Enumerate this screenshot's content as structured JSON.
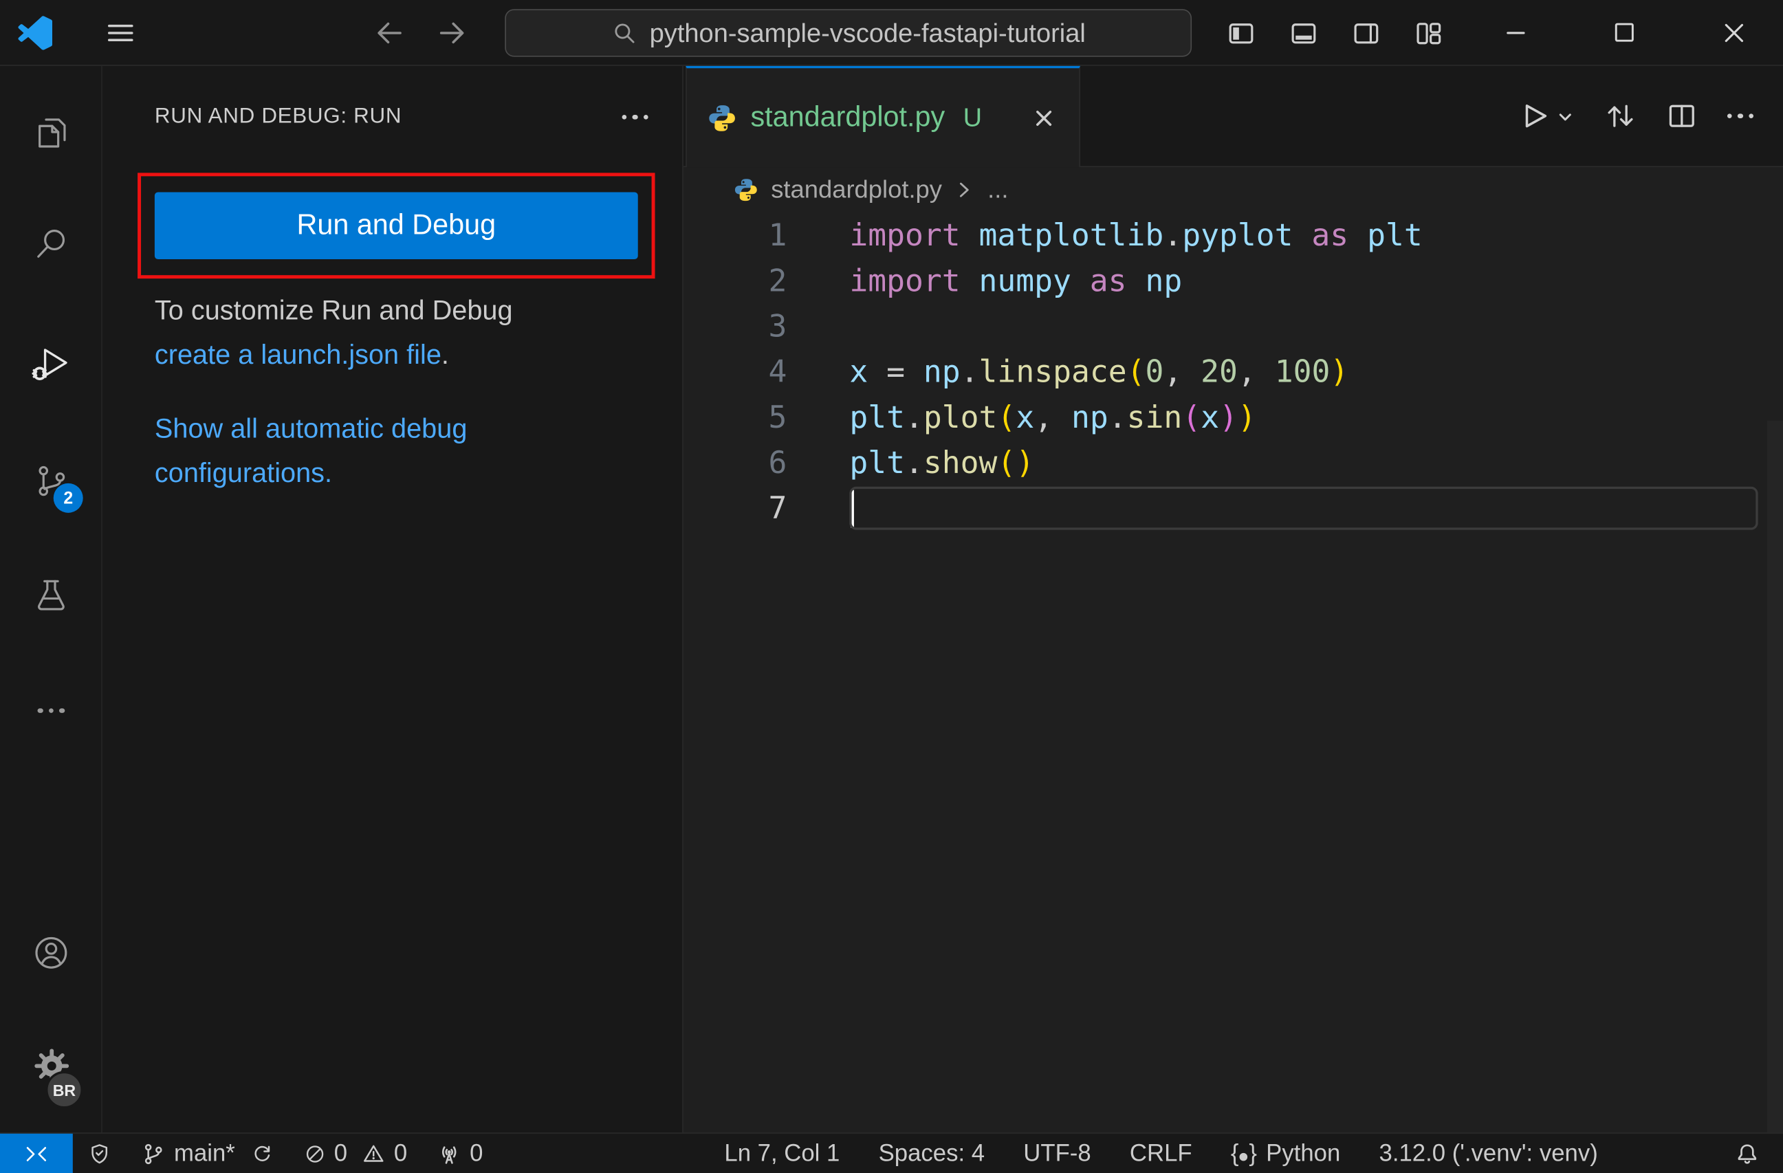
{
  "title_bar": {
    "command_center_text": "python-sample-vscode-fastapi-tutorial"
  },
  "activity_bar": {
    "source_control_badge": "2",
    "profile_badge": "BR"
  },
  "sidebar": {
    "title": "RUN AND DEBUG: RUN",
    "run_and_debug_button": "Run and Debug",
    "customize_line": "To customize Run and Debug",
    "launch_json_link": "create a launch.json file",
    "launch_json_suffix": ".",
    "show_configs_line1": "Show all automatic debug",
    "show_configs_line2": "configurations."
  },
  "editor": {
    "tab_title": "standardplot.py",
    "tab_git_status": "U",
    "breadcrumb_file": "standardplot.py",
    "breadcrumb_more": "...",
    "code_lines": [
      {
        "num": "1",
        "tokens": [
          [
            "kw",
            "import "
          ],
          [
            "v",
            "matplotlib"
          ],
          [
            "o",
            "."
          ],
          [
            "v",
            "pyplot"
          ],
          [
            "kw",
            " as "
          ],
          [
            "v",
            "plt"
          ]
        ]
      },
      {
        "num": "2",
        "tokens": [
          [
            "kw",
            "import "
          ],
          [
            "v",
            "numpy"
          ],
          [
            "kw",
            " as "
          ],
          [
            "v",
            "np"
          ]
        ]
      },
      {
        "num": "3",
        "tokens": []
      },
      {
        "num": "4",
        "tokens": [
          [
            "v",
            "x"
          ],
          [
            "o",
            " = "
          ],
          [
            "v",
            "np"
          ],
          [
            "o",
            "."
          ],
          [
            "fn",
            "linspace"
          ],
          [
            "b1",
            "("
          ],
          [
            "n",
            "0"
          ],
          [
            "o",
            ", "
          ],
          [
            "n",
            "20"
          ],
          [
            "o",
            ", "
          ],
          [
            "n",
            "100"
          ],
          [
            "b1",
            ")"
          ]
        ]
      },
      {
        "num": "5",
        "tokens": [
          [
            "v",
            "plt"
          ],
          [
            "o",
            "."
          ],
          [
            "fn",
            "plot"
          ],
          [
            "b1",
            "("
          ],
          [
            "v",
            "x"
          ],
          [
            "o",
            ", "
          ],
          [
            "v",
            "np"
          ],
          [
            "o",
            "."
          ],
          [
            "fn",
            "sin"
          ],
          [
            "b2",
            "("
          ],
          [
            "v",
            "x"
          ],
          [
            "b2",
            ")"
          ],
          [
            "b1",
            ")"
          ]
        ]
      },
      {
        "num": "6",
        "tokens": [
          [
            "v",
            "plt"
          ],
          [
            "o",
            "."
          ],
          [
            "fn",
            "show"
          ],
          [
            "b1",
            "("
          ],
          [
            "b1",
            ")"
          ]
        ]
      },
      {
        "num": "7",
        "tokens": [],
        "current": true,
        "cursor": true
      }
    ]
  },
  "status_bar": {
    "branch": "main*",
    "errors": "0",
    "warnings": "0",
    "ports": "0",
    "cursor_position": "Ln 7, Col 1",
    "indentation": "Spaces: 4",
    "encoding": "UTF-8",
    "eol": "CRLF",
    "language_icon_open": "{",
    "language_icon_close": "}",
    "language": "Python",
    "interpreter": "3.12.0 ('.venv': venv)"
  },
  "colors": {
    "accent_blue": "#0078d4",
    "annotation_red": "#ee1111",
    "link_blue": "#4daafc",
    "untracked_green": "#73c991",
    "syntax_keyword": "#c586c0",
    "syntax_variable": "#9cdcfe",
    "syntax_function": "#dcdcaa",
    "syntax_number": "#b5cea8",
    "bracket_level1": "#ffd700",
    "bracket_level2": "#da70d6"
  }
}
